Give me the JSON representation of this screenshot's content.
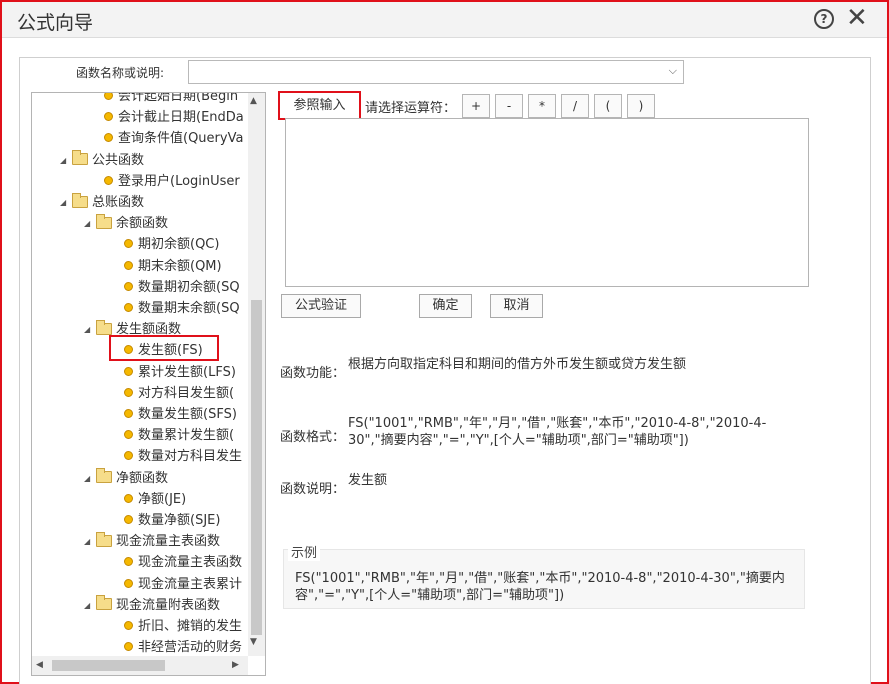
{
  "window": {
    "title": "公式向导"
  },
  "name_search": {
    "label": "函数名称或说明:",
    "value": ""
  },
  "tree": [
    {
      "label": "会计起始日期(Begin",
      "indent": 3,
      "kind": "leaf",
      "expanded": null
    },
    {
      "label": "会计截止日期(EndDa",
      "indent": 3,
      "kind": "leaf",
      "expanded": null
    },
    {
      "label": "查询条件值(QueryVa",
      "indent": 3,
      "kind": "leaf",
      "expanded": null
    },
    {
      "label": "公共函数",
      "indent": 1,
      "kind": "folder",
      "expanded": true
    },
    {
      "label": "登录用户(LoginUser",
      "indent": 3,
      "kind": "leaf",
      "expanded": null
    },
    {
      "label": "总账函数",
      "indent": 1,
      "kind": "folder",
      "expanded": true
    },
    {
      "label": "余额函数",
      "indent": 2,
      "kind": "folder",
      "expanded": true
    },
    {
      "label": "期初余额(QC)",
      "indent": 4,
      "kind": "leaf",
      "expanded": null
    },
    {
      "label": "期末余额(QM)",
      "indent": 4,
      "kind": "leaf",
      "expanded": null
    },
    {
      "label": "数量期初余额(SQ",
      "indent": 4,
      "kind": "leaf",
      "expanded": null
    },
    {
      "label": "数量期末余额(SQ",
      "indent": 4,
      "kind": "leaf",
      "expanded": null
    },
    {
      "label": "发生额函数",
      "indent": 2,
      "kind": "folder",
      "expanded": true
    },
    {
      "label": "发生额(FS)",
      "indent": 4,
      "kind": "leaf",
      "expanded": null,
      "selected": true
    },
    {
      "label": "累计发生额(LFS)",
      "indent": 4,
      "kind": "leaf",
      "expanded": null
    },
    {
      "label": "对方科目发生额(",
      "indent": 4,
      "kind": "leaf",
      "expanded": null
    },
    {
      "label": "数量发生额(SFS)",
      "indent": 4,
      "kind": "leaf",
      "expanded": null
    },
    {
      "label": "数量累计发生额(",
      "indent": 4,
      "kind": "leaf",
      "expanded": null
    },
    {
      "label": "数量对方科目发生",
      "indent": 4,
      "kind": "leaf",
      "expanded": null
    },
    {
      "label": "净额函数",
      "indent": 2,
      "kind": "folder",
      "expanded": true
    },
    {
      "label": "净额(JE)",
      "indent": 4,
      "kind": "leaf",
      "expanded": null
    },
    {
      "label": "数量净额(SJE)",
      "indent": 4,
      "kind": "leaf",
      "expanded": null
    },
    {
      "label": "现金流量主表函数",
      "indent": 2,
      "kind": "folder",
      "expanded": true
    },
    {
      "label": "现金流量主表函数",
      "indent": 4,
      "kind": "leaf",
      "expanded": null
    },
    {
      "label": "现金流量主表累计",
      "indent": 4,
      "kind": "leaf",
      "expanded": null
    },
    {
      "label": "现金流量附表函数",
      "indent": 2,
      "kind": "folder",
      "expanded": true
    },
    {
      "label": "折旧、摊销的发生",
      "indent": 4,
      "kind": "leaf",
      "expanded": null
    },
    {
      "label": "非经营活动的财务",
      "indent": 4,
      "kind": "leaf",
      "expanded": null
    }
  ],
  "toolbar": {
    "ref_input_label": "参照输入",
    "operator_label": "请选择运算符：",
    "operators": [
      "+",
      "-",
      "*",
      "/",
      "(",
      ")"
    ]
  },
  "formula": {
    "value": ""
  },
  "actions": {
    "verify_label": "公式验证",
    "ok_label": "确定",
    "cancel_label": "取消"
  },
  "info": {
    "function_label": "函数功能：",
    "function_value": "根据方向取指定科目和期间的借方外币发生额或贷方发生额",
    "format_label": "函数格式：",
    "format_value": "FS(\"1001\",\"RMB\",\"年\",\"月\",\"借\",\"账套\",\"本币\",\"2010-4-8\",\"2010-4-30\",\"摘要内容\",\"=\",\"Y\",[个人=\"辅助项\",部门=\"辅助项\"])",
    "desc_label": "函数说明：",
    "desc_value": "发生额"
  },
  "example": {
    "legend": "示例",
    "text": "FS(\"1001\",\"RMB\",\"年\",\"月\",\"借\",\"账套\",\"本币\",\"2010-4-8\",\"2010-4-30\",\"摘要内容\",\"=\",\"Y\",[个人=\"辅助项\",部门=\"辅助项\"])"
  }
}
